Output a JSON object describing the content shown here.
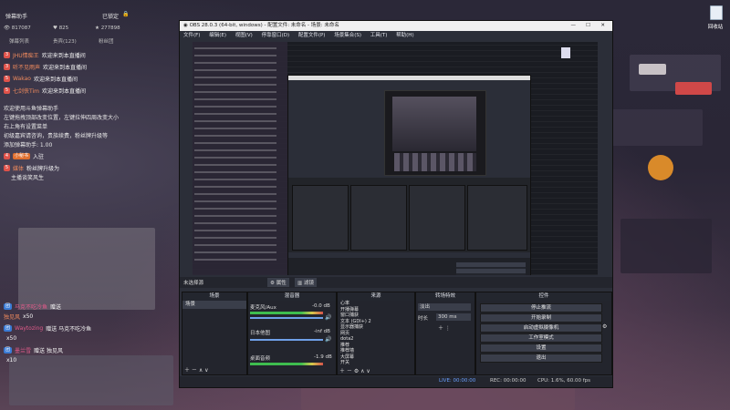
{
  "danmu": {
    "header": {
      "title": "弹幕助手",
      "status": "已锁定"
    },
    "stats": {
      "viewers": "817087",
      "fans": "825",
      "gifts": "277898"
    },
    "tabs": [
      "弹幕列表",
      "贵宾(123)",
      "粉丝团"
    ],
    "lines": [
      {
        "level": "3",
        "user": "JHU情痴王",
        "msg": "欢迎来到本直播间"
      },
      {
        "level": "3",
        "user": "听不见雨声",
        "msg": "欢迎来到本直播间"
      },
      {
        "level": "5",
        "user": "Wakao",
        "msg": "欢迎来到本直播间"
      },
      {
        "level": "5",
        "user": "七剑侠Tim",
        "msg": "欢迎来到本直播间"
      }
    ],
    "system": [
      "欢迎使用斗鱼弹幕助手",
      "左键拖拽顶部改变位置，左键拉伸四周改变大小",
      "右上角有设置菜单",
      "初级嘉宾请咨询，贵族续费，粉丝牌升级等",
      "添加弹幕助手: 1.00"
    ],
    "gift_line": {
      "user": "小秘书",
      "text": "入驻"
    },
    "welcome": {
      "user": "媒体",
      "text": "粉丝牌升级为",
      "extra": "主播谈笑风生"
    },
    "bottom_lines": [
      {
        "user": "马克不吃冷鱼",
        "text": "赠送"
      },
      {
        "user": "独见风",
        "text": "x50"
      },
      {
        "user": "Waytozing",
        "text": "赠送 马克不吃冷鱼"
      },
      {
        "user": "",
        "text": "x50"
      },
      {
        "user": "墨兰雪",
        "text": "赠送 独见风"
      },
      {
        "user": "",
        "text": "x10"
      }
    ]
  },
  "obs": {
    "title": "OBS 28.0.3 (64-bit, windows) - 配置文件: 未命名 - 场景: 未命名",
    "menu": [
      "文件(F)",
      "编辑(E)",
      "视图(V)",
      "停靠窗口(D)",
      "配置文件(P)",
      "场景集合(S)",
      "工具(T)",
      "帮助(H)"
    ],
    "no_source": "未选择源",
    "props_btn": "属性",
    "filter_btn": "滤镜",
    "scenes": {
      "title": "场景",
      "items": [
        "场景"
      ]
    },
    "sources": {
      "title": "来源",
      "items": [
        "心率",
        "开播弹幕",
        "窗口捕获",
        "文本 (GDI+) 2",
        "显示器捕获",
        "网页",
        "dota2",
        "推荐",
        "推荐墙",
        "大屏幕",
        "开关"
      ]
    },
    "mixer": {
      "title": "混音器",
      "channels": [
        {
          "name": "麦克风/Aux",
          "db": "-0.0 dB"
        },
        {
          "name": "日本他图",
          "db": "-inf dB"
        },
        {
          "name": "桌面音频",
          "db": "-1.9 dB"
        }
      ]
    },
    "transitions": {
      "title": "转场特效",
      "mode": "淡出",
      "duration_label": "时长",
      "duration": "300 ms"
    },
    "controls": {
      "title": "控件",
      "buttons": [
        "停止推流",
        "开始录制",
        "启动虚拟摄像机",
        "工作室模式",
        "设置",
        "退出"
      ]
    },
    "status": {
      "live": "LIVE: 00:00:00",
      "rec": "REC: 00:00:00",
      "cpu": "CPU: 1.6%, 60.00 fps"
    }
  },
  "desktop": {
    "recycle_label": "回收站"
  },
  "colors": {
    "accent": "#3c404c",
    "live_red": "#d33",
    "panel": "#23252d"
  }
}
